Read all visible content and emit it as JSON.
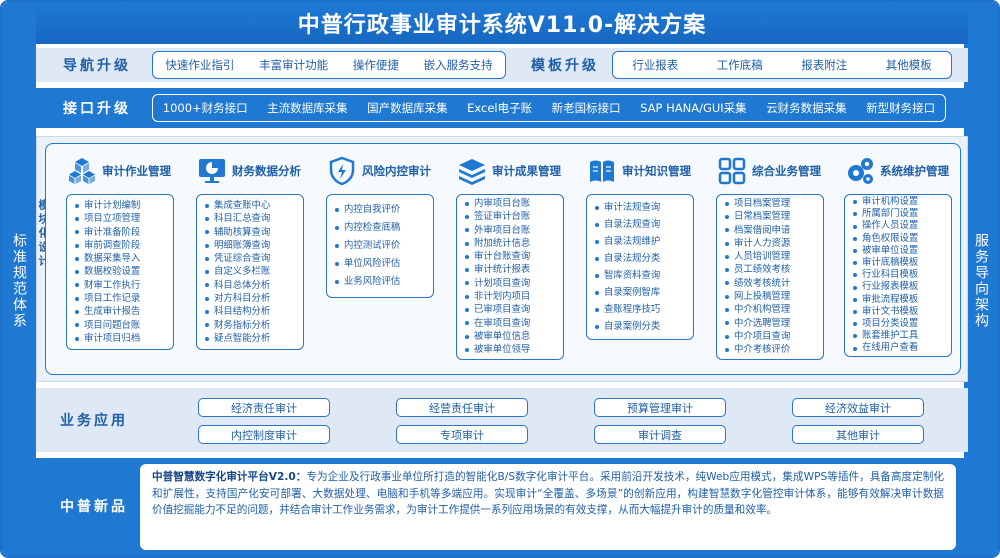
{
  "title": "中普行政事业审计系统V11.0-解决方案",
  "left_side": "标准规范体系",
  "right_side": "服务导向架构",
  "nav": {
    "label": "导航升级",
    "items": [
      "快速作业指引",
      "丰富审计功能",
      "操作便捷",
      "嵌入服务支持"
    ],
    "template_label": "模板升级",
    "template_items": [
      "行业报表",
      "工作底稿",
      "报表附注",
      "其他模板"
    ]
  },
  "interface": {
    "label": "接口升级",
    "items": [
      "1000+财务接口",
      "主流数据库采集",
      "国产数据库采集",
      "Excel电子账",
      "新老国标接口",
      "SAP HANA/GUI采集",
      "云财务数据采集",
      "新型财务接口"
    ]
  },
  "modules": {
    "side_label": "模块化设计",
    "list": [
      {
        "name": "审计作业管理",
        "icon": "cubes-icon",
        "items": [
          "审计计划编制",
          "项目立项管理",
          "审计准备阶段",
          "审前调查阶段",
          "数据采集导入",
          "数据校验设置",
          "财审工作执行",
          "项目工作记录",
          "生成审计报告",
          "项目问题台账",
          "审计项目归档"
        ]
      },
      {
        "name": "财务数据分析",
        "icon": "chart-screen-icon",
        "items": [
          "集成查账中心",
          "科目汇总查询",
          "辅助核算查询",
          "明细账簿查询",
          "凭证综合查询",
          "自定义多栏账",
          "科目总体分析",
          "对方科目分析",
          "科目结构分析",
          "财务指标分析",
          "疑点智能分析"
        ]
      },
      {
        "name": "风险内控审计",
        "icon": "shield-icon",
        "items": [
          "内控自我评价",
          "内控检查底稿",
          "内控测试评价",
          "单位风险评估",
          "业务风险评估"
        ]
      },
      {
        "name": "审计成果管理",
        "icon": "layers-icon",
        "items": [
          "内审项目台账",
          "签证审计台账",
          "外审项目台账",
          "附加统计信息",
          "审计台账查询",
          "审计统计报表",
          "计划项目查询",
          "非计划内项目",
          "已审项目查询",
          "在审项目查询",
          "被审单位信息",
          "被审单位领导"
        ]
      },
      {
        "name": "审计知识管理",
        "icon": "book-icon",
        "items": [
          "审计法规查询",
          "自录法规查询",
          "自录法规维护",
          "自录法规分类",
          "智库资料查询",
          "自录案例智库",
          "查账程序技巧",
          "自录案例分类"
        ]
      },
      {
        "name": "综合业务管理",
        "icon": "grid-icon",
        "items": [
          "项目档案管理",
          "日常档案管理",
          "档案借阅申请",
          "审计人力资源",
          "人员培训管理",
          "员工绩效考核",
          "绩效考核统计",
          "网上投稿管理",
          "中介机构管理",
          "中介选聘管理",
          "中介项目查询",
          "中介考核评价"
        ]
      },
      {
        "name": "系统维护管理",
        "icon": "gears-icon",
        "items": [
          "审计机构设置",
          "所属部门设置",
          "操作人员设置",
          "角色权限设置",
          "被审单位设置",
          "审计底稿模板",
          "行业科目模板",
          "行业报表模板",
          "审批流程模板",
          "审计文书模板",
          "项目分类设置",
          "账套维护工具",
          "在线用户查看"
        ]
      }
    ]
  },
  "business": {
    "label": "业务应用",
    "items": [
      "经济责任审计",
      "经营责任审计",
      "预算管理审计",
      "经济效益审计",
      "内控制度审计",
      "专项审计",
      "审计调查",
      "其他审计"
    ]
  },
  "news": {
    "label": "中普新品",
    "lead": "中普智慧数字化审计平台V2.0：",
    "body": "专为企业及行政事业单位所打造的智能化B/S数字化审计平台。采用前沿开发技术，纯Web应用模式，集成WPS等插件，具备高度定制化和扩展性，支持国产化安可部署、大数据处理、电脑和手机等多端应用。实现审计“全覆盖、多场景”的创新应用，构建智慧数字化管控审计体系，能够有效解决审计数据价值挖掘能力不足的问题，并结合审计工作业务需求，为审计工作提供一系列应用场景的有效支撑，从而大幅提升审计的质量和效率。"
  },
  "colors": {
    "primary": "#1f78d1",
    "text": "#1f5fa8",
    "band_light": "#dfe9f5"
  }
}
